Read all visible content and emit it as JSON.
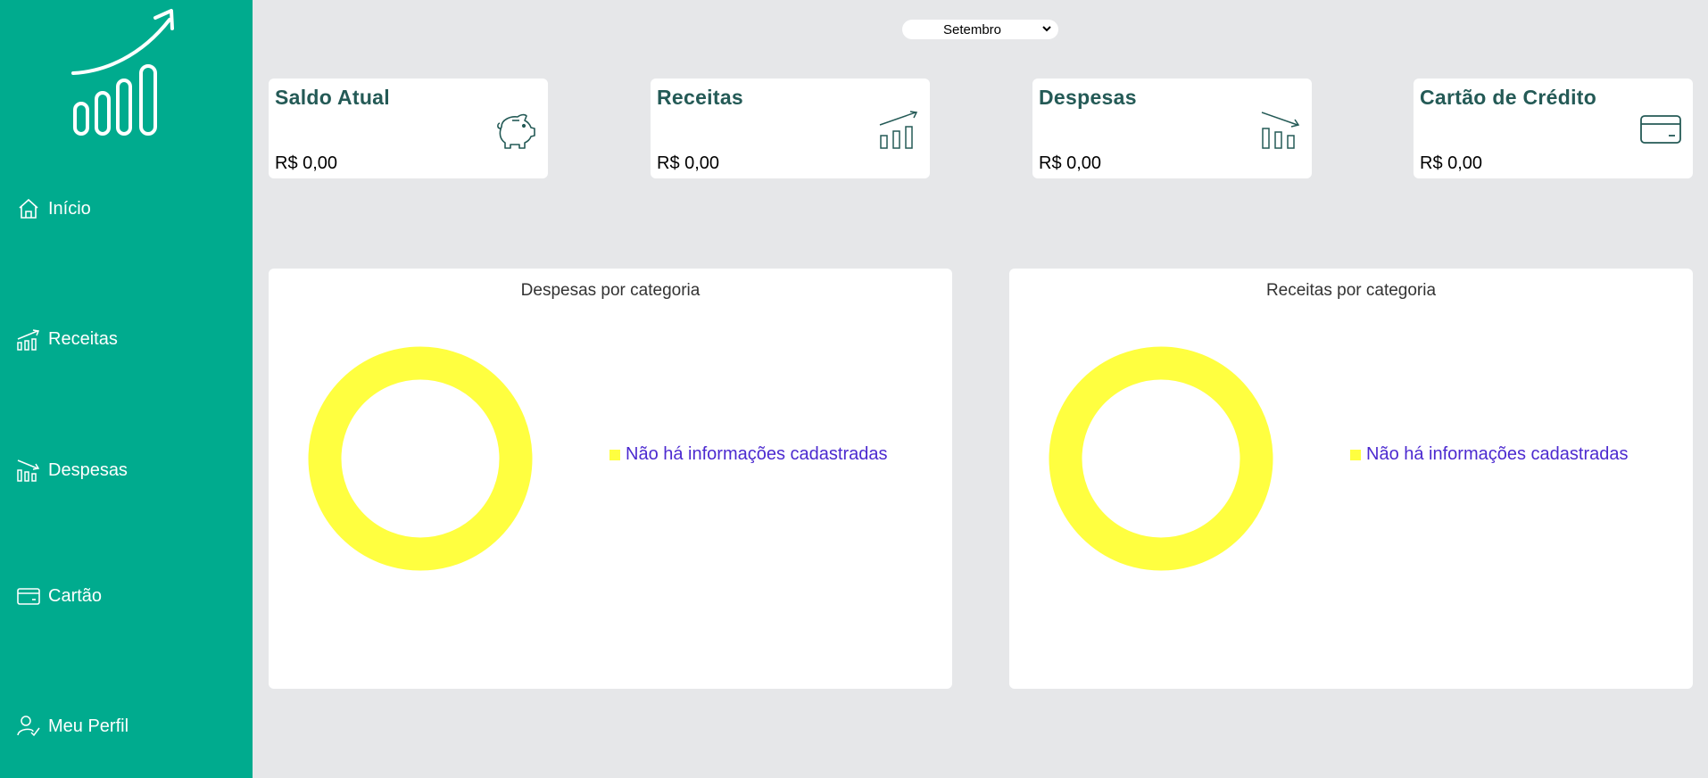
{
  "sidebar": {
    "items": [
      {
        "label": "Início",
        "icon": "home-icon"
      },
      {
        "label": "Receitas",
        "icon": "trend-up-bars-icon"
      },
      {
        "label": "Despesas",
        "icon": "trend-down-bars-icon"
      },
      {
        "label": "Cartão",
        "icon": "credit-card-icon"
      },
      {
        "label": "Meu Perfil",
        "icon": "user-check-icon"
      }
    ],
    "logo_icon": "growth-chart-logo-icon"
  },
  "header": {
    "month_select": {
      "value": "Setembro"
    }
  },
  "summary_cards": [
    {
      "title": "Saldo Atual",
      "value": "R$ 0,00",
      "icon": "piggy-bank-icon"
    },
    {
      "title": "Receitas",
      "value": "R$ 0,00",
      "icon": "trend-up-bars-icon"
    },
    {
      "title": "Despesas",
      "value": "R$ 0,00",
      "icon": "trend-down-bars-icon"
    },
    {
      "title": "Cartão de Crédito",
      "value": "R$ 0,00",
      "icon": "credit-card-icon"
    }
  ],
  "charts": [
    {
      "title": "Despesas por categoria",
      "legend": "Não há informações cadastradas"
    },
    {
      "title": "Receitas por categoria",
      "legend": "Não há informações cadastradas"
    }
  ],
  "colors": {
    "sidebar": "#00ab8e",
    "card_title": "#245a56",
    "donut_empty": "#ffff40",
    "legend_text": "#4c2ad0",
    "background": "#e6e7e9"
  }
}
